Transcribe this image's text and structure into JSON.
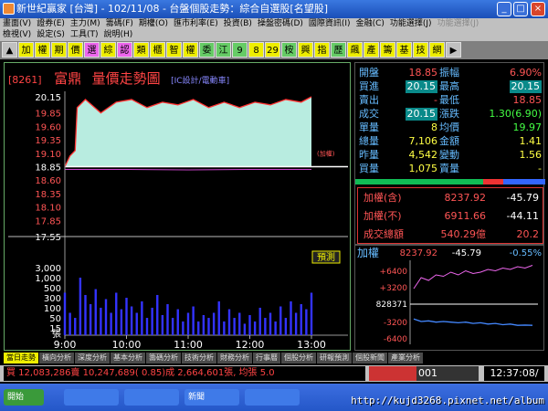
{
  "window": {
    "title": "新世紀贏家 [台灣] - 102/11/08 - 台盤個股走勢：綜合自選股[名望股]",
    "min": "_",
    "max": "□",
    "close": "×"
  },
  "menu1": [
    "畫面(V)",
    "證券(E)",
    "主力(M)",
    "籌碼(F)",
    "期權(O)",
    "匯市利率(E)",
    "投資(B)",
    "操盤密碼(D)",
    "國際資訊(I)",
    "金融(C)",
    "功能選擇(J)",
    "功能選擇(J)"
  ],
  "menu2": [
    "檢視(V)",
    "設定(S)",
    "工具(T)",
    "說明(H)"
  ],
  "toolbar": [
    {
      "label": "▲",
      "bg": "#c0c0c0"
    },
    {
      "label": "加",
      "bg": "#ee0"
    },
    {
      "label": "權",
      "bg": "#ee0"
    },
    {
      "label": "期",
      "bg": "#ee0"
    },
    {
      "label": "價",
      "bg": "#ee0"
    },
    {
      "label": "選",
      "bg": "#e6e"
    },
    {
      "label": "綜",
      "bg": "#ee0"
    },
    {
      "label": "認",
      "bg": "#e6e"
    },
    {
      "label": "類",
      "bg": "#ee0"
    },
    {
      "label": "櫃",
      "bg": "#ee0"
    },
    {
      "label": "智",
      "bg": "#ee0"
    },
    {
      "label": "權",
      "bg": "#ee0"
    },
    {
      "label": "委",
      "bg": "#6c6"
    },
    {
      "label": "江",
      "bg": "#6c6"
    },
    {
      "label": "9",
      "bg": "#6c6"
    },
    {
      "label": "8",
      "bg": "#ee0"
    },
    {
      "label": "29",
      "bg": "#ee0"
    },
    {
      "label": "桉",
      "bg": "#6c6"
    },
    {
      "label": "興",
      "bg": "#ee0"
    },
    {
      "label": "指",
      "bg": "#ee0"
    },
    {
      "label": "歷",
      "bg": "#6c6"
    },
    {
      "label": "飆",
      "bg": "#ee0"
    },
    {
      "label": "產",
      "bg": "#ee0"
    },
    {
      "label": "籌",
      "bg": "#ee0"
    },
    {
      "label": "基",
      "bg": "#ee0"
    },
    {
      "label": "技",
      "bg": "#ee0"
    },
    {
      "label": "網",
      "bg": "#ee0"
    },
    {
      "label": "▶",
      "bg": "#c0c0c0"
    }
  ],
  "chart_header": {
    "code": "[8261]",
    "name": "富鼎",
    "title": "量價走勢圖",
    "sub": "[IC設計/電動車]"
  },
  "chart_data": {
    "type": "line",
    "title": "量價走勢圖",
    "price_ylim": [
      17.55,
      20.15
    ],
    "price_ticks": [
      "20.15",
      "19.85",
      "19.60",
      "19.35",
      "19.10",
      "18.85",
      "18.60",
      "18.35",
      "18.10",
      "17.85",
      "17.55"
    ],
    "reference_price": 18.85,
    "reference_label": "(加權)",
    "x_ticks": [
      "9:00",
      "10:00",
      "11:00",
      "12:00",
      "13:00"
    ],
    "volume_ticks": [
      "3,000",
      "1,000",
      "500",
      "300",
      "100",
      "50",
      "15"
    ],
    "volume_unit": "張",
    "predict_label": "預測",
    "price_series": [
      [
        "09:00",
        18.85
      ],
      [
        "09:05",
        19.05
      ],
      [
        "09:10",
        19.15
      ],
      [
        "09:12",
        19.95
      ],
      [
        "09:20",
        20.1
      ],
      [
        "09:35",
        19.85
      ],
      [
        "09:50",
        20.05
      ],
      [
        "10:05",
        20.1
      ],
      [
        "10:20",
        19.95
      ],
      [
        "10:35",
        20.05
      ],
      [
        "10:50",
        20.0
      ],
      [
        "11:05",
        20.1
      ],
      [
        "11:20",
        19.95
      ],
      [
        "11:35",
        20.05
      ],
      [
        "11:50",
        19.95
      ],
      [
        "12:05",
        20.05
      ],
      [
        "12:20",
        20.0
      ],
      [
        "12:35",
        20.1
      ],
      [
        "12:50",
        20.05
      ],
      [
        "13:00",
        20.15
      ]
    ],
    "index_series": [
      [
        "09:00",
        18.8
      ],
      [
        "10:00",
        18.8
      ],
      [
        "11:00",
        18.79
      ],
      [
        "12:00",
        18.8
      ],
      [
        "13:00",
        18.8
      ]
    ],
    "volume_series": [
      [
        "09:00",
        300
      ],
      [
        "09:05",
        60
      ],
      [
        "09:10",
        40
      ],
      [
        "09:15",
        1000
      ],
      [
        "09:20",
        250
      ],
      [
        "09:25",
        120
      ],
      [
        "09:30",
        400
      ],
      [
        "09:35",
        90
      ],
      [
        "09:40",
        180
      ],
      [
        "09:45",
        60
      ],
      [
        "09:50",
        300
      ],
      [
        "09:55",
        80
      ],
      [
        "10:00",
        200
      ],
      [
        "10:05",
        100
      ],
      [
        "10:10",
        60
      ],
      [
        "10:15",
        150
      ],
      [
        "10:20",
        40
      ],
      [
        "10:25",
        90
      ],
      [
        "10:30",
        250
      ],
      [
        "10:35",
        50
      ],
      [
        "10:40",
        120
      ],
      [
        "10:45",
        40
      ],
      [
        "10:50",
        80
      ],
      [
        "10:55",
        30
      ],
      [
        "11:00",
        60
      ],
      [
        "11:05",
        100
      ],
      [
        "11:10",
        30
      ],
      [
        "11:15",
        50
      ],
      [
        "11:20",
        40
      ],
      [
        "11:25",
        60
      ],
      [
        "11:30",
        150
      ],
      [
        "11:35",
        30
      ],
      [
        "11:40",
        80
      ],
      [
        "11:45",
        40
      ],
      [
        "11:50",
        60
      ],
      [
        "11:55",
        25
      ],
      [
        "12:00",
        50
      ],
      [
        "12:05",
        30
      ],
      [
        "12:10",
        90
      ],
      [
        "12:15",
        40
      ],
      [
        "12:20",
        60
      ],
      [
        "12:25",
        30
      ],
      [
        "12:30",
        100
      ],
      [
        "12:35",
        40
      ],
      [
        "12:40",
        150
      ],
      [
        "12:45",
        60
      ],
      [
        "12:50",
        120
      ],
      [
        "12:55",
        80
      ],
      [
        "13:00",
        300
      ]
    ],
    "colors": {
      "price": "#f33",
      "fill": "#b8ece0",
      "index": "#c4c",
      "volume": "#33f",
      "axis_gray": "#999"
    }
  },
  "quote": {
    "rows": [
      {
        "l1": "開盤",
        "v1": "18.85",
        "c1": "red",
        "l2": "振幅",
        "v2": "6.90%",
        "c2": "red"
      },
      {
        "l1": "買進",
        "v1": "20.15",
        "c1": "hl",
        "l2": "最高",
        "v2": "20.15",
        "c2": "hl"
      },
      {
        "l1": "賣出",
        "v1": "-",
        "c1": "red",
        "l2": "最低",
        "v2": "18.85",
        "c2": "red"
      },
      {
        "l1": "成交",
        "v1": "20.15",
        "c1": "hl",
        "l2": "漲跌",
        "v2": "1.30(6.90)",
        "c2": "green"
      },
      {
        "l1": "單量",
        "v1": "8",
        "c1": "yellow",
        "l2": "均價",
        "v2": "19.97",
        "c2": "green"
      },
      {
        "l1": "總量",
        "v1": "7,106",
        "c1": "yellow",
        "l2": "金額",
        "v2": "1.41",
        "c2": "yellow"
      },
      {
        "l1": "昨量",
        "v1": "4,542",
        "c1": "yellow",
        "l2": "變動",
        "v2": "1.56",
        "c2": "yellow"
      },
      {
        "l1": "買量",
        "v1": "1,075",
        "c1": "yellow",
        "l2": "賣量",
        "v2": "-",
        "c2": "yellow"
      }
    ]
  },
  "index_box": [
    {
      "label": "加權(含)",
      "value": "8237.92",
      "change": "-45.79"
    },
    {
      "label": "加權(不)",
      "value": "6911.66",
      "change": "-44.11"
    },
    {
      "label": "成交總額",
      "value": "540.29億",
      "change": "20.2"
    }
  ],
  "mini_chart": {
    "label": "加權",
    "value": "8237.92",
    "change": "-45.79",
    "pct": "-0.55%",
    "top_ticks": [
      "+6400",
      "+3200"
    ],
    "mid": "828371",
    "bottom_ticks": [
      "-3200",
      "-6400"
    ],
    "upper_series": [
      0.1,
      0.5,
      0.4,
      0.6,
      0.55,
      0.7,
      0.6,
      0.75,
      0.65,
      0.7,
      0.8,
      0.75,
      0.85,
      0.8,
      0.9,
      0.85,
      0.95
    ],
    "lower_series": [
      0.3,
      0.5,
      0.45,
      0.55,
      0.5,
      0.55,
      0.6,
      0.55,
      0.65,
      0.6,
      0.7,
      0.65,
      0.75,
      0.7,
      0.8,
      0.78,
      0.8
    ]
  },
  "tabs": [
    "當日走勢",
    "橫向分析",
    "深度分析",
    "基本分析",
    "籌碼分析",
    "技術分析",
    "財務分析",
    "行事曆",
    "個股分析",
    "研報預測",
    "個股新聞",
    "產業分析"
  ],
  "status": {
    "text": "買 12,083,286賣 10,247,689( 0.85)成 2,664,601張, 均張 5.0",
    "page": "001",
    "clock": "12:37:08/"
  },
  "taskbar": {
    "items": [
      "開始",
      "",
      "",
      "新聞",
      ""
    ],
    "watermark": "http://kujd3268.pixnet.net/album"
  }
}
